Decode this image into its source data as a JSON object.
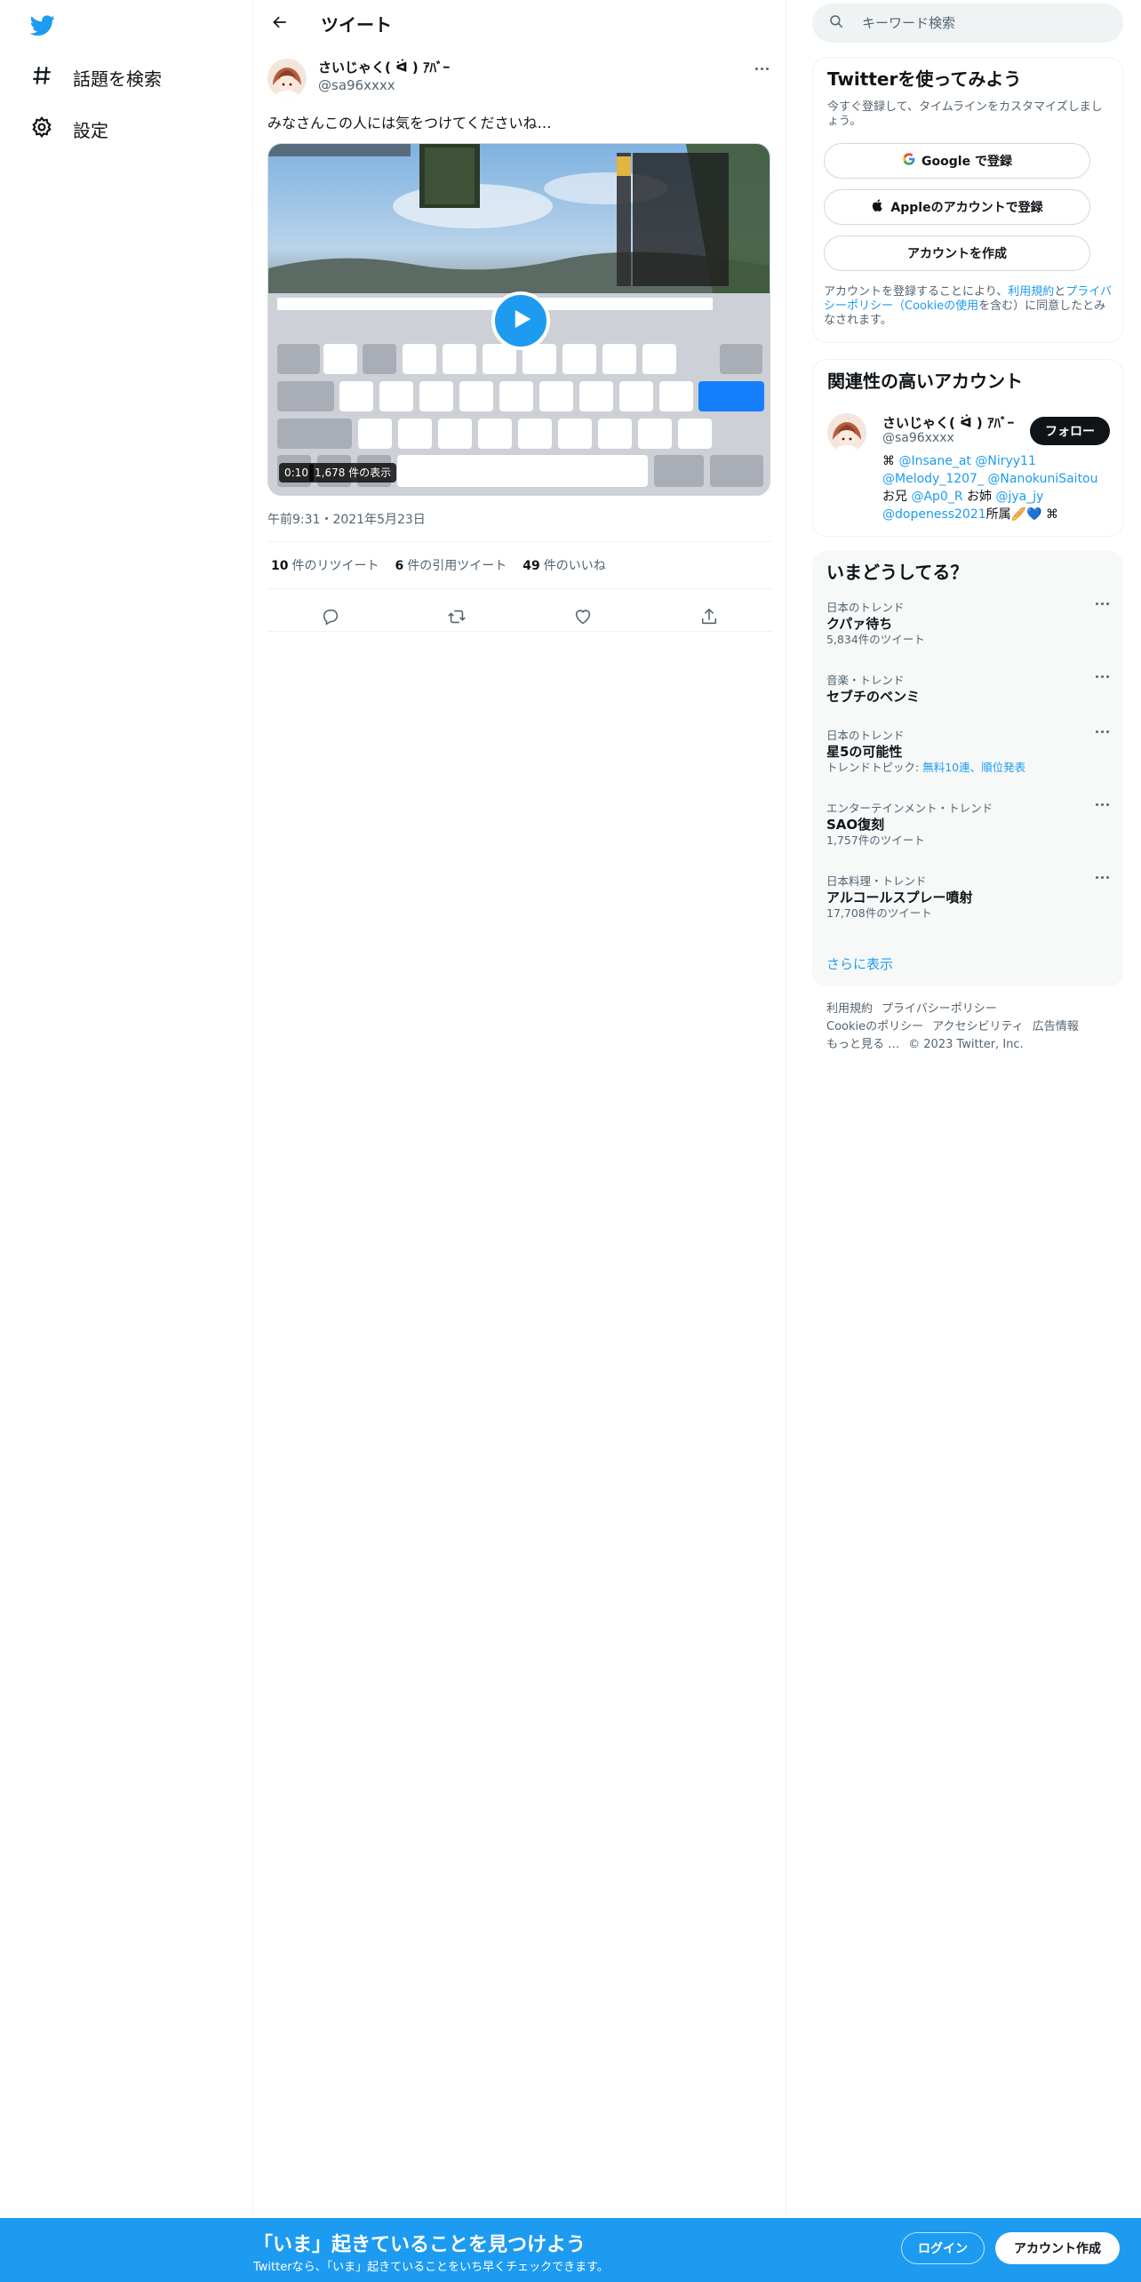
{
  "nav": {
    "logo_icon": "twitter-bird-icon",
    "items": [
      {
        "icon": "hashtag-icon",
        "label": "話題を検索"
      },
      {
        "icon": "gear-icon",
        "label": "設定"
      }
    ]
  },
  "main": {
    "header_title": "ツイート",
    "tweet": {
      "author_name": "さいじゃく( ᐛ ) ｱﾊﾞｰ",
      "author_handle": "@sa96xxxx",
      "text": "みなさんこの人には気をつけてくださいね…",
      "video": {
        "duration": "0:10",
        "views": "1,678 件の表示"
      },
      "timestamp": "午前9:31・2021年5月23日",
      "stats": {
        "retweets_count": "10",
        "retweets_label": "件のリツイート",
        "quotes_count": "6",
        "quotes_label": "件の引用ツイート",
        "likes_count": "49",
        "likes_label": "件のいいね"
      }
    }
  },
  "sidebar": {
    "search_placeholder": "キーワード検索",
    "signup": {
      "title": "Twitterを使ってみよう",
      "subtitle": "今すぐ登録して、タイムラインをカスタマイズしましょう。",
      "google_button": "Google で登録",
      "apple_button": "Appleのアカウントで登録",
      "create_button": "アカウントを作成",
      "legal_1": "アカウントを登録することにより、",
      "legal_terms": "利用規約",
      "legal_2": "と",
      "legal_privacy": "プライバシーポリシー（Cookieの使用",
      "legal_3": "を含む）に同意したとみなされます。"
    },
    "relevant": {
      "title": "関連性の高いアカウント",
      "name": "さいじゃく( ᐛ ) ｱﾊﾞｰ",
      "handle": "@sa96xxxx",
      "follow_label": "フォロー",
      "bio_1": "⌘ ",
      "bio_m1": "@Insane_at",
      "bio_m2": "@Niryy11",
      "bio_m3": "@Melody_1207_",
      "bio_m4": "@NanokuniSaitou",
      "bio_2": " お兄 ",
      "bio_m5": "@Ap0_R",
      "bio_3": " お姉 ",
      "bio_m6": "@jya_jy",
      "bio_m7": "@dopeness2021",
      "bio_4": "所属🥖💙 ⌘"
    },
    "trends": {
      "title": "いまどうしてる？",
      "items": [
        {
          "meta": "日本のトレンド",
          "name": "クパァ待ち",
          "count": "5,834件のツイート"
        },
        {
          "meta": "音楽・トレンド",
          "name": "セブチのベンミ",
          "count": ""
        },
        {
          "meta": "日本のトレンド",
          "name": "星5の可能性",
          "count": "トレンドトピック: ",
          "topic": "無料10連、順位発表"
        },
        {
          "meta": "エンターテインメント・トレンド",
          "name": "SAO復刻",
          "count": "1,757件のツイート"
        },
        {
          "meta": "日本料理・トレンド",
          "name": "アルコールスプレー噴射",
          "count": "17,708件のツイート"
        }
      ],
      "show_more": "さらに表示"
    },
    "footer": {
      "terms": "利用規約",
      "privacy": "プライバシーポリシー",
      "cookie": "Cookieのポリシー",
      "accessibility": "アクセシビリティ",
      "ads": "広告情報",
      "more": "もっと見る …",
      "copyright": "© 2023 Twitter, Inc."
    }
  },
  "banner": {
    "title": "「いま」起きていることを見つけよう",
    "subtitle": "Twitterなら、「いま」起きていることをいち早くチェックできます。",
    "login": "ログイン",
    "signup": "アカウント作成"
  }
}
